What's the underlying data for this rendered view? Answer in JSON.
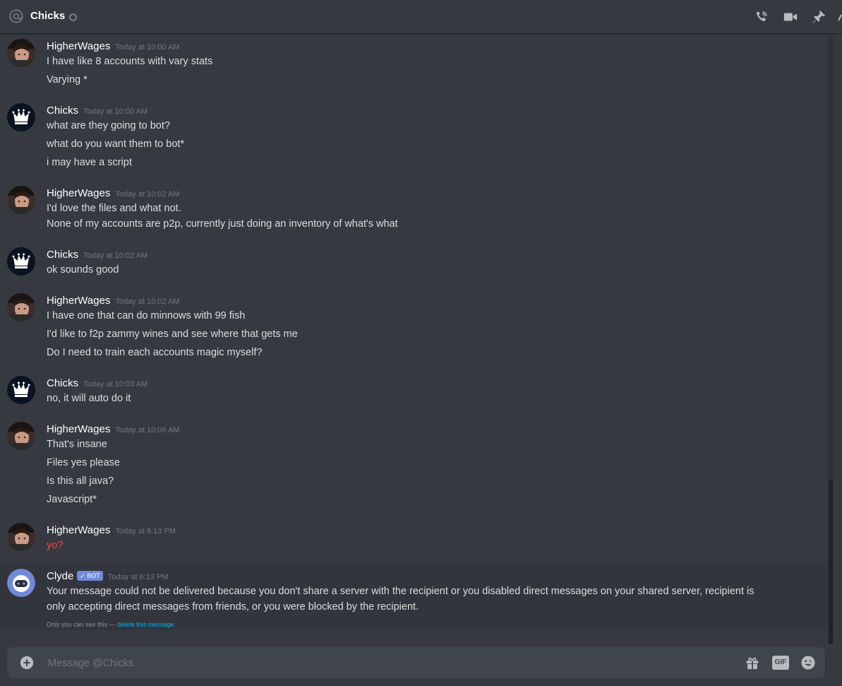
{
  "header": {
    "title": "Chicks",
    "icons": [
      "at-icon",
      "phone-call-icon",
      "video-call-icon",
      "pin-icon"
    ]
  },
  "messages": [
    {
      "author": "HigherWages",
      "time": "Today at 10:00 AM",
      "lines": [
        "I have like 8 accounts with vary stats",
        "Varying *"
      ]
    },
    {
      "author": "Chicks",
      "time": "Today at 10:00 AM",
      "lines": [
        "what are they going to bot?",
        "what do you want them to bot*",
        "i may have a script"
      ]
    },
    {
      "author": "HigherWages",
      "time": "Today at 10:02 AM",
      "lines": [
        "I'd love the files and what not.",
        "None of my accounts are p2p, currently just doing an inventory of what's what"
      ]
    },
    {
      "author": "Chicks",
      "time": "Today at 10:02 AM",
      "lines": [
        "ok sounds good"
      ]
    },
    {
      "author": "HigherWages",
      "time": "Today at 10:02 AM",
      "lines": [
        "I have one that can do minnows with 99 fish",
        "I'd like to f2p zammy wines and see where that gets me",
        "Do I need to train each accounts magic myself?"
      ]
    },
    {
      "author": "Chicks",
      "time": "Today at 10:03 AM",
      "lines": [
        "no, it will auto do it"
      ]
    },
    {
      "author": "HigherWages",
      "time": "Today at 10:06 AM",
      "lines": [
        "That's insane",
        "Files yes please",
        "Is this all java?",
        "Javascript*"
      ]
    },
    {
      "author": "HigherWages",
      "time": "Today at 6:13 PM",
      "lines": [
        "yo?"
      ]
    },
    {
      "author": "Clyde",
      "badge": "BOT",
      "time": "Today at 6:13 PM",
      "lines": [
        "Your message could not be delivered because you don't share a server with the recipient or you disabled direct messages on your shared server, recipient is",
        "only accepting direct messages from friends, or you were blocked by the recipient."
      ]
    }
  ],
  "system_note": {
    "prefix": "Only you can see this — ",
    "link": "delete this message."
  },
  "composer": {
    "placeholder": "Message @Chicks",
    "gif_label": "GIF"
  },
  "colors": {
    "background": "#36393f",
    "error_text": "#f04747",
    "bot_badge": "#7289da",
    "link": "#00b0f4"
  }
}
